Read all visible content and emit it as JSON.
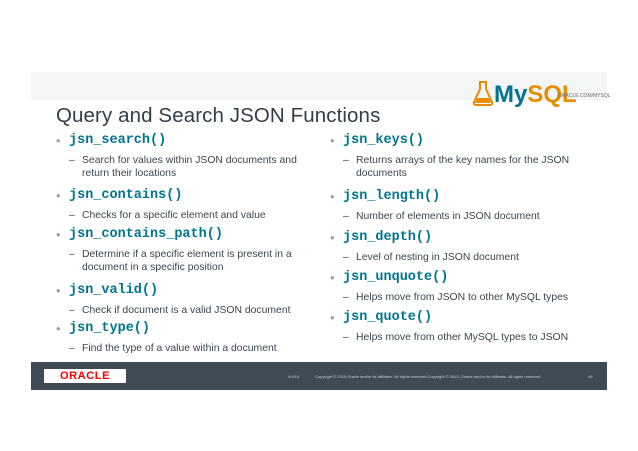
{
  "slide": {
    "title": "Query and Search JSON Functions",
    "logo": {
      "my": "My",
      "sql": "SQL",
      "trademark": "ORACLE.COM/MYSQL"
    },
    "left_items": [
      {
        "fn": "jsn_search()",
        "desc": "Search for values within JSON documents and return their locations"
      },
      {
        "fn": "jsn_contains()",
        "desc": "Checks for a specific element and value"
      },
      {
        "fn": "jsn_contains_path()",
        "desc": "Determine if a specific element is present in a document in a specific position"
      },
      {
        "fn": "jsn_valid()",
        "desc": "Check if document is a valid JSON document"
      },
      {
        "fn": "jsn_type()",
        "desc": "Find the type of a value within a document"
      }
    ],
    "right_items": [
      {
        "fn": "jsn_keys()",
        "desc": "Returns arrays of the key names for the JSON documents"
      },
      {
        "fn": "jsn_length()",
        "desc": "Number of elements in JSON document"
      },
      {
        "fn": "jsn_depth()",
        "desc": "Level of nesting in JSON document"
      },
      {
        "fn": "jsn_unquote()",
        "desc": "Helps move from JSON to other MySQL types"
      },
      {
        "fn": "jsn_quote()",
        "desc": "Helps move from other MySQL types to JSON"
      }
    ],
    "footer": {
      "brand": "ORACLE",
      "date": "4/4/16",
      "copyright": "Copyright © 2015 Oracle and/or its affiliates. All rights reserved.Copyright © 2015, Oracle and/or its affiliates. All rights reserved.",
      "page": "49"
    }
  },
  "colors": {
    "accent": "#00758f",
    "mysql_orange": "#e48e00",
    "footer": "#3f4a54",
    "oracle_red": "#f80000"
  }
}
